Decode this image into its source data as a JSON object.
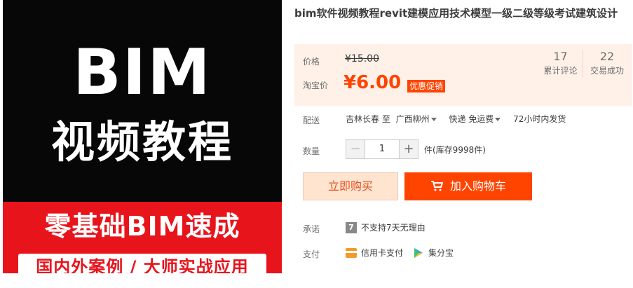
{
  "product_image": {
    "headline": "BIM",
    "subtitle": "视频教程",
    "banner": "零基础BIM速成",
    "tagline": "国内外案例 / 大师实战应用"
  },
  "title": "bim软件视频教程revit建模应用技术模型一级二级等级考试建筑设计",
  "price": {
    "original_label": "价格",
    "original_value": "¥15.00",
    "promo_label": "淘宝价",
    "promo_value": "¥6.00",
    "promo_tag": "优惠促销"
  },
  "stats": {
    "reviews_count": "17",
    "reviews_label": "累计评论",
    "deals_count": "22",
    "deals_label": "交易成功"
  },
  "shipping": {
    "label": "配送",
    "from": "吉林长春 至",
    "to": "广西柳州",
    "method": "快递 免运费",
    "time": "72小时内发货"
  },
  "quantity": {
    "label": "数量",
    "value": "1",
    "minus": "−",
    "plus": "+",
    "stock": "件(库存9998件)"
  },
  "buttons": {
    "buy_now": "立即购买",
    "add_cart": "加入购物车"
  },
  "promise": {
    "label": "承诺",
    "badge": "7",
    "text": "不支持7天无理由"
  },
  "payment": {
    "label": "支付",
    "credit": "信用卡支付",
    "jfb": "集分宝"
  },
  "colors": {
    "accent": "#ff4400",
    "panel_bg": "#fff1e8"
  }
}
